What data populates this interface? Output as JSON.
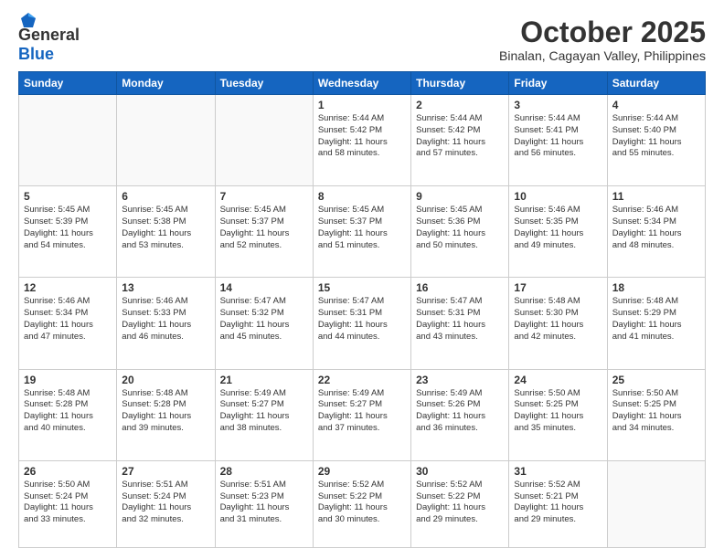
{
  "header": {
    "logo_line1": "General",
    "logo_line2": "Blue",
    "month": "October 2025",
    "location": "Binalan, Cagayan Valley, Philippines"
  },
  "weekdays": [
    "Sunday",
    "Monday",
    "Tuesday",
    "Wednesday",
    "Thursday",
    "Friday",
    "Saturday"
  ],
  "weeks": [
    [
      {
        "day": "",
        "detail": ""
      },
      {
        "day": "",
        "detail": ""
      },
      {
        "day": "",
        "detail": ""
      },
      {
        "day": "1",
        "detail": "Sunrise: 5:44 AM\nSunset: 5:42 PM\nDaylight: 11 hours\nand 58 minutes."
      },
      {
        "day": "2",
        "detail": "Sunrise: 5:44 AM\nSunset: 5:42 PM\nDaylight: 11 hours\nand 57 minutes."
      },
      {
        "day": "3",
        "detail": "Sunrise: 5:44 AM\nSunset: 5:41 PM\nDaylight: 11 hours\nand 56 minutes."
      },
      {
        "day": "4",
        "detail": "Sunrise: 5:44 AM\nSunset: 5:40 PM\nDaylight: 11 hours\nand 55 minutes."
      }
    ],
    [
      {
        "day": "5",
        "detail": "Sunrise: 5:45 AM\nSunset: 5:39 PM\nDaylight: 11 hours\nand 54 minutes."
      },
      {
        "day": "6",
        "detail": "Sunrise: 5:45 AM\nSunset: 5:38 PM\nDaylight: 11 hours\nand 53 minutes."
      },
      {
        "day": "7",
        "detail": "Sunrise: 5:45 AM\nSunset: 5:37 PM\nDaylight: 11 hours\nand 52 minutes."
      },
      {
        "day": "8",
        "detail": "Sunrise: 5:45 AM\nSunset: 5:37 PM\nDaylight: 11 hours\nand 51 minutes."
      },
      {
        "day": "9",
        "detail": "Sunrise: 5:45 AM\nSunset: 5:36 PM\nDaylight: 11 hours\nand 50 minutes."
      },
      {
        "day": "10",
        "detail": "Sunrise: 5:46 AM\nSunset: 5:35 PM\nDaylight: 11 hours\nand 49 minutes."
      },
      {
        "day": "11",
        "detail": "Sunrise: 5:46 AM\nSunset: 5:34 PM\nDaylight: 11 hours\nand 48 minutes."
      }
    ],
    [
      {
        "day": "12",
        "detail": "Sunrise: 5:46 AM\nSunset: 5:34 PM\nDaylight: 11 hours\nand 47 minutes."
      },
      {
        "day": "13",
        "detail": "Sunrise: 5:46 AM\nSunset: 5:33 PM\nDaylight: 11 hours\nand 46 minutes."
      },
      {
        "day": "14",
        "detail": "Sunrise: 5:47 AM\nSunset: 5:32 PM\nDaylight: 11 hours\nand 45 minutes."
      },
      {
        "day": "15",
        "detail": "Sunrise: 5:47 AM\nSunset: 5:31 PM\nDaylight: 11 hours\nand 44 minutes."
      },
      {
        "day": "16",
        "detail": "Sunrise: 5:47 AM\nSunset: 5:31 PM\nDaylight: 11 hours\nand 43 minutes."
      },
      {
        "day": "17",
        "detail": "Sunrise: 5:48 AM\nSunset: 5:30 PM\nDaylight: 11 hours\nand 42 minutes."
      },
      {
        "day": "18",
        "detail": "Sunrise: 5:48 AM\nSunset: 5:29 PM\nDaylight: 11 hours\nand 41 minutes."
      }
    ],
    [
      {
        "day": "19",
        "detail": "Sunrise: 5:48 AM\nSunset: 5:28 PM\nDaylight: 11 hours\nand 40 minutes."
      },
      {
        "day": "20",
        "detail": "Sunrise: 5:48 AM\nSunset: 5:28 PM\nDaylight: 11 hours\nand 39 minutes."
      },
      {
        "day": "21",
        "detail": "Sunrise: 5:49 AM\nSunset: 5:27 PM\nDaylight: 11 hours\nand 38 minutes."
      },
      {
        "day": "22",
        "detail": "Sunrise: 5:49 AM\nSunset: 5:27 PM\nDaylight: 11 hours\nand 37 minutes."
      },
      {
        "day": "23",
        "detail": "Sunrise: 5:49 AM\nSunset: 5:26 PM\nDaylight: 11 hours\nand 36 minutes."
      },
      {
        "day": "24",
        "detail": "Sunrise: 5:50 AM\nSunset: 5:25 PM\nDaylight: 11 hours\nand 35 minutes."
      },
      {
        "day": "25",
        "detail": "Sunrise: 5:50 AM\nSunset: 5:25 PM\nDaylight: 11 hours\nand 34 minutes."
      }
    ],
    [
      {
        "day": "26",
        "detail": "Sunrise: 5:50 AM\nSunset: 5:24 PM\nDaylight: 11 hours\nand 33 minutes."
      },
      {
        "day": "27",
        "detail": "Sunrise: 5:51 AM\nSunset: 5:24 PM\nDaylight: 11 hours\nand 32 minutes."
      },
      {
        "day": "28",
        "detail": "Sunrise: 5:51 AM\nSunset: 5:23 PM\nDaylight: 11 hours\nand 31 minutes."
      },
      {
        "day": "29",
        "detail": "Sunrise: 5:52 AM\nSunset: 5:22 PM\nDaylight: 11 hours\nand 30 minutes."
      },
      {
        "day": "30",
        "detail": "Sunrise: 5:52 AM\nSunset: 5:22 PM\nDaylight: 11 hours\nand 29 minutes."
      },
      {
        "day": "31",
        "detail": "Sunrise: 5:52 AM\nSunset: 5:21 PM\nDaylight: 11 hours\nand 29 minutes."
      },
      {
        "day": "",
        "detail": ""
      }
    ]
  ]
}
